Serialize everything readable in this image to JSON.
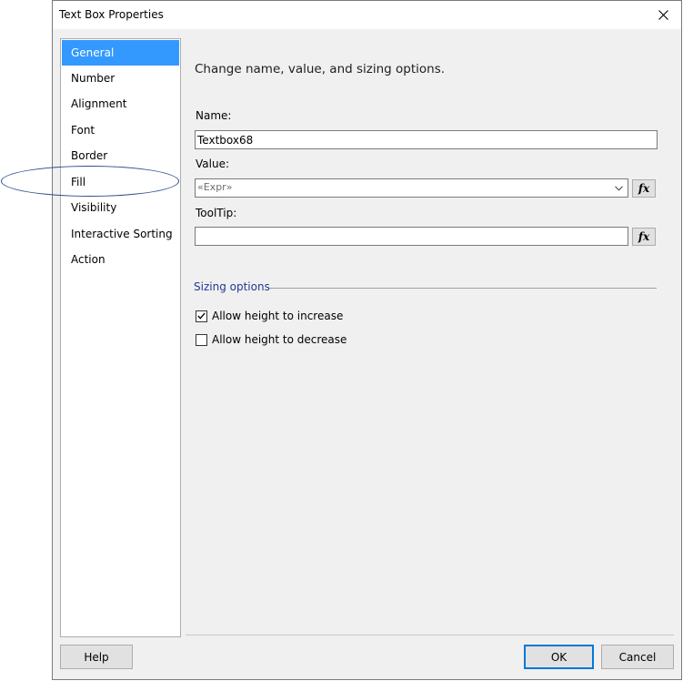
{
  "window": {
    "title": "Text Box Properties",
    "close_icon": "close-icon"
  },
  "nav": {
    "items": [
      {
        "label": "General",
        "selected": true
      },
      {
        "label": "Number"
      },
      {
        "label": "Alignment"
      },
      {
        "label": "Font"
      },
      {
        "label": "Border"
      },
      {
        "label": "Fill"
      },
      {
        "label": "Visibility"
      },
      {
        "label": "Interactive Sorting"
      },
      {
        "label": "Action"
      }
    ]
  },
  "general": {
    "heading": "Change name, value, and sizing options.",
    "name_label": "Name:",
    "name_value": "Textbox68",
    "value_label": "Value:",
    "value_value": "«Expr»",
    "tooltip_label": "ToolTip:",
    "tooltip_value": "",
    "fx_label": "fx",
    "sizing_title": "Sizing options",
    "allow_increase": {
      "label": "Allow height to increase",
      "checked": true
    },
    "allow_decrease": {
      "label": "Allow height to decrease",
      "checked": false
    }
  },
  "buttons": {
    "help": "Help",
    "ok": "OK",
    "cancel": "Cancel"
  },
  "colors": {
    "selection": "#3399ff",
    "section_title": "#1f3a93",
    "annotation": "#2e4f8a",
    "default_button_border": "#0078d7"
  }
}
